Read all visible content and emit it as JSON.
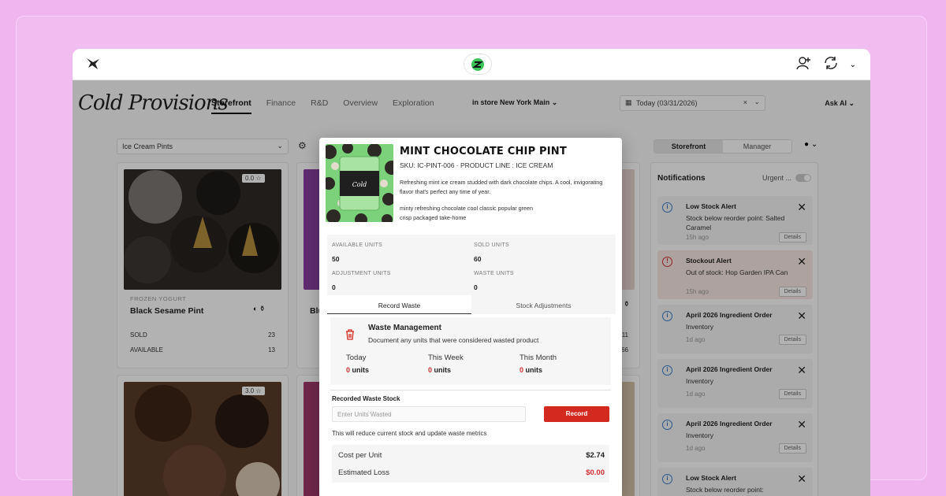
{
  "app": {
    "brand": "Cold Provisions"
  },
  "nav": {
    "items": [
      "Storefront",
      "Finance",
      "R&D",
      "Overview",
      "Exploration"
    ],
    "active": "Storefront",
    "location": "in store New York Main",
    "date": "Today (03/31/2026)",
    "ask_ai": "Ask AI"
  },
  "filters": {
    "category": "Ice Cream Pints",
    "view_toggle": [
      "Storefront",
      "Manager"
    ]
  },
  "cards": [
    {
      "rating": "0.0",
      "category": "FROZEN YOGURT",
      "name": "Black Sesame Pint",
      "sold_label": "SOLD",
      "sold": "23",
      "available_label": "AVAILABLE",
      "available": "13"
    },
    {
      "name": "Blu",
      "sold": "11",
      "available": "66"
    },
    {
      "rating": "3.0"
    }
  ],
  "notifications": {
    "title": "Notifications",
    "urgent_label": "Urgent ...",
    "details_label": "Details",
    "items": [
      {
        "type": "info",
        "title": "Low Stock Alert",
        "desc": "Stock below reorder point: Salted Caramel",
        "age": "15h ago"
      },
      {
        "type": "alert",
        "title": "Stockout Alert",
        "desc": "Out of stock: Hop Garden IPA Can",
        "age": "15h ago"
      },
      {
        "type": "info",
        "title": "April 2026 Ingredient Order",
        "desc": "Inventory",
        "age": "1d ago"
      },
      {
        "type": "info",
        "title": "April 2026 Ingredient Order",
        "desc": "Inventory",
        "age": "1d ago"
      },
      {
        "type": "info",
        "title": "April 2026 Ingredient Order",
        "desc": "Inventory",
        "age": "1d ago"
      },
      {
        "type": "info",
        "title": "Low Stock Alert",
        "desc": "Stock below reorder point:",
        "age": ""
      }
    ]
  },
  "modal": {
    "title": "MINT CHOCOLATE CHIP PINT",
    "sku": "SKU: IC-PINT-006 · PRODUCT LINE : ICE CREAM",
    "description": "Refreshing mint ice cream studded with dark chocolate chips. A cool, invigorating flavor that's perfect any time of year.",
    "tags_line1": "minty refreshing chocolate cool classic popular green",
    "tags_line2": "crisp packaged take-home",
    "stats": [
      {
        "label": "AVAILABLE UNITS",
        "value": "50"
      },
      {
        "label": "SOLD UNITS",
        "value": "60"
      },
      {
        "label": "ADJUSTMENT UNITS",
        "value": "0"
      },
      {
        "label": "WASTE UNITS",
        "value": "0"
      }
    ],
    "tabs": [
      "Record Waste",
      "Stock Adjustments"
    ],
    "waste": {
      "title": "Waste Management",
      "subtitle": "Document any units that were considered wasted product",
      "periods": [
        {
          "label": "Today",
          "value": "0",
          "unit": "units"
        },
        {
          "label": "This Week",
          "value": "0",
          "unit": "units"
        },
        {
          "label": "This Month",
          "value": "0",
          "unit": "units"
        }
      ],
      "recorded_label": "Recorded Waste Stock",
      "input_placeholder": "Enter Units Wasted",
      "record_button": "Record",
      "note": "This will reduce current stock and update waste metrics",
      "cost_label": "Cost per Unit",
      "cost_value": "$2.74",
      "loss_label": "Estimated Loss",
      "loss_value": "$0.00"
    }
  },
  "colors": {
    "accent_red": "#d32a1f",
    "info_blue": "#3a7bc8",
    "background_pink": "#f0b4ef"
  }
}
